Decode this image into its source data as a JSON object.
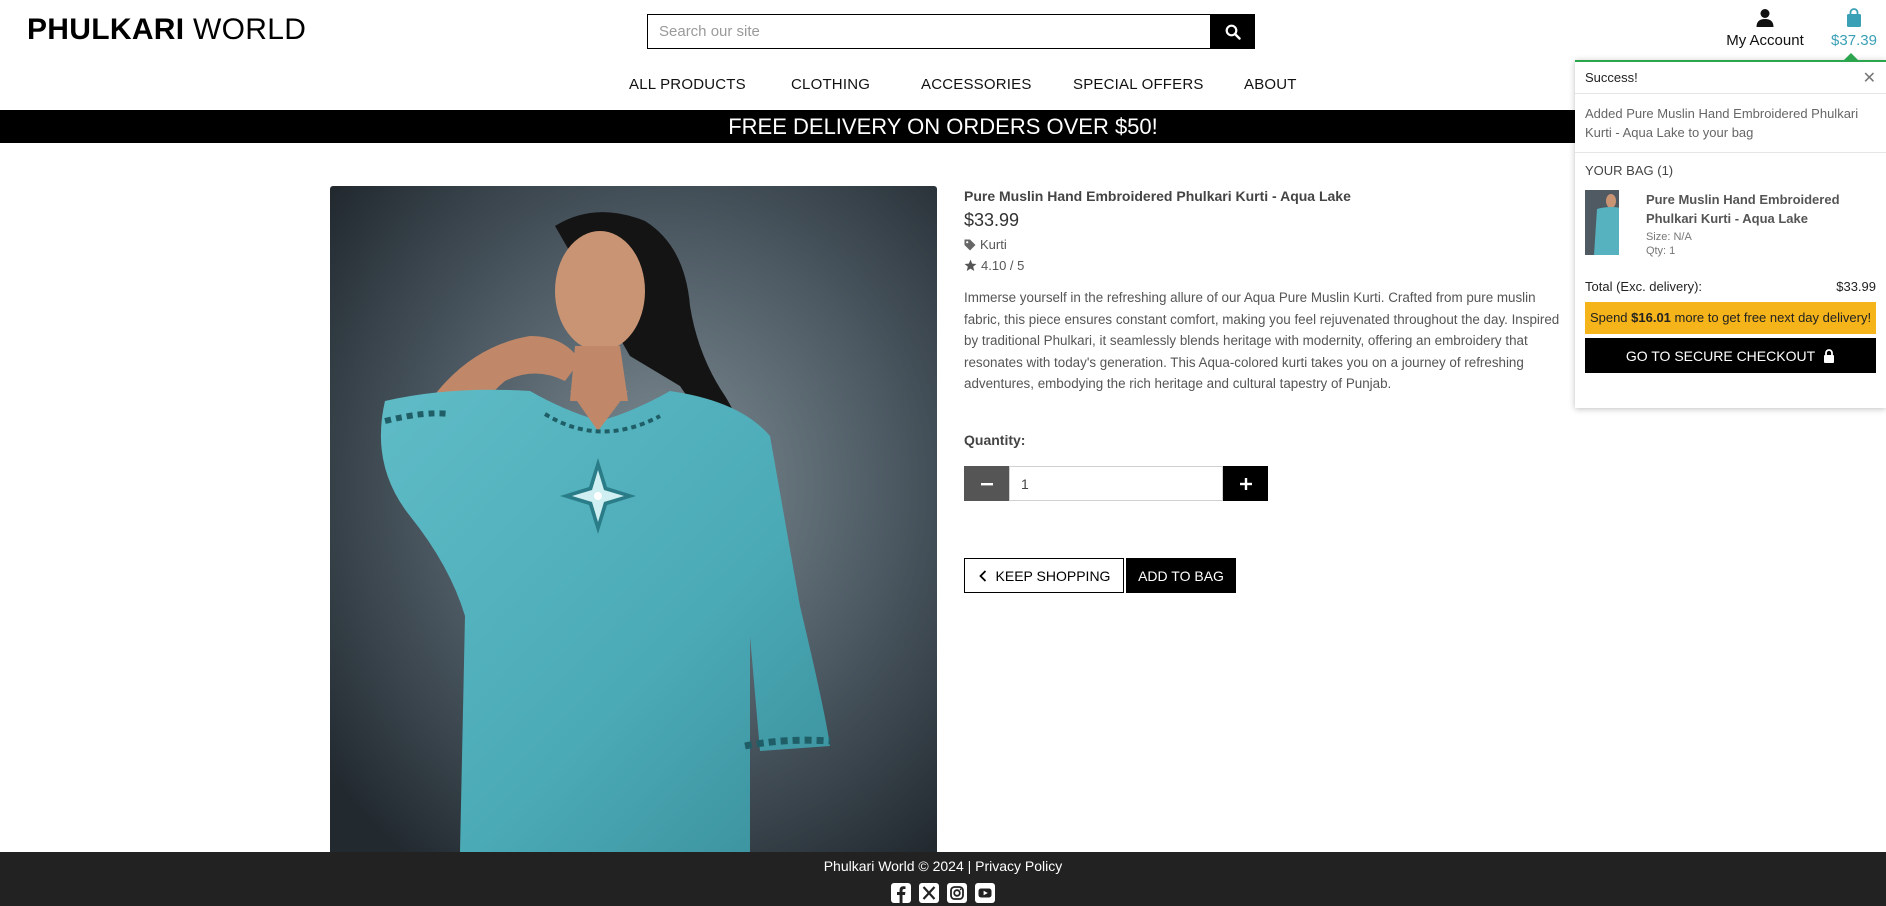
{
  "header": {
    "logo_bold": "PHULKARI",
    "logo_light": "WORLD",
    "search_placeholder": "Search our site",
    "account_label": "My Account",
    "bag_total": "$37.39"
  },
  "nav": {
    "items": [
      "ALL PRODUCTS",
      "CLOTHING",
      "ACCESSORIES",
      "SPECIAL OFFERS",
      "ABOUT"
    ]
  },
  "banner": {
    "text": "FREE DELIVERY ON ORDERS OVER $50!"
  },
  "product": {
    "name": "Pure Muslin Hand Embroidered Phulkari Kurti - Aqua Lake",
    "price": "$33.99",
    "category": "Kurti",
    "rating": "4.10 / 5",
    "description": "Immerse yourself in the refreshing allure of our Aqua Pure Muslin Kurti. Crafted from pure muslin fabric, this piece ensures constant comfort, making you feel rejuvenated throughout the day. Inspired by traditional Phulkari, it seamlessly blends heritage with modernity, offering an embroidery that resonates with today's generation. This Aqua-colored kurti takes you on a journey of refreshing adventures, embodying the rich heritage and cultural tapestry of Punjab.",
    "quantity_label": "Quantity:",
    "quantity_value": "1",
    "keep_shopping": "KEEP SHOPPING",
    "add_to_bag": "ADD TO BAG"
  },
  "toast": {
    "title": "Success!",
    "message": "Added Pure Muslin Hand Embroidered Phulkari Kurti - Aqua Lake to your bag",
    "bag_heading": "YOUR BAG (1)",
    "item_name": "Pure Muslin Hand Embroidered Phulkari Kurti - Aqua Lake",
    "item_size": "Size: N/A",
    "item_qty": "Qty: 1",
    "total_label": "Total (Exc. delivery):",
    "total_value": "$33.99",
    "spend_prefix": "Spend ",
    "spend_amount": "$16.01",
    "spend_suffix": " more to get free next day delivery!",
    "checkout": "GO TO SECURE CHECKOUT"
  },
  "footer": {
    "copyright": "Phulkari World © 2024 | Privacy Policy",
    "social_icons": [
      "facebook-icon",
      "x-icon",
      "instagram-icon",
      "youtube-icon"
    ]
  },
  "colors": {
    "accent_bag": "#3aa0b5",
    "success_border": "#2da44e",
    "spend_bar": "#f5b419",
    "footer_bg": "#222222"
  }
}
